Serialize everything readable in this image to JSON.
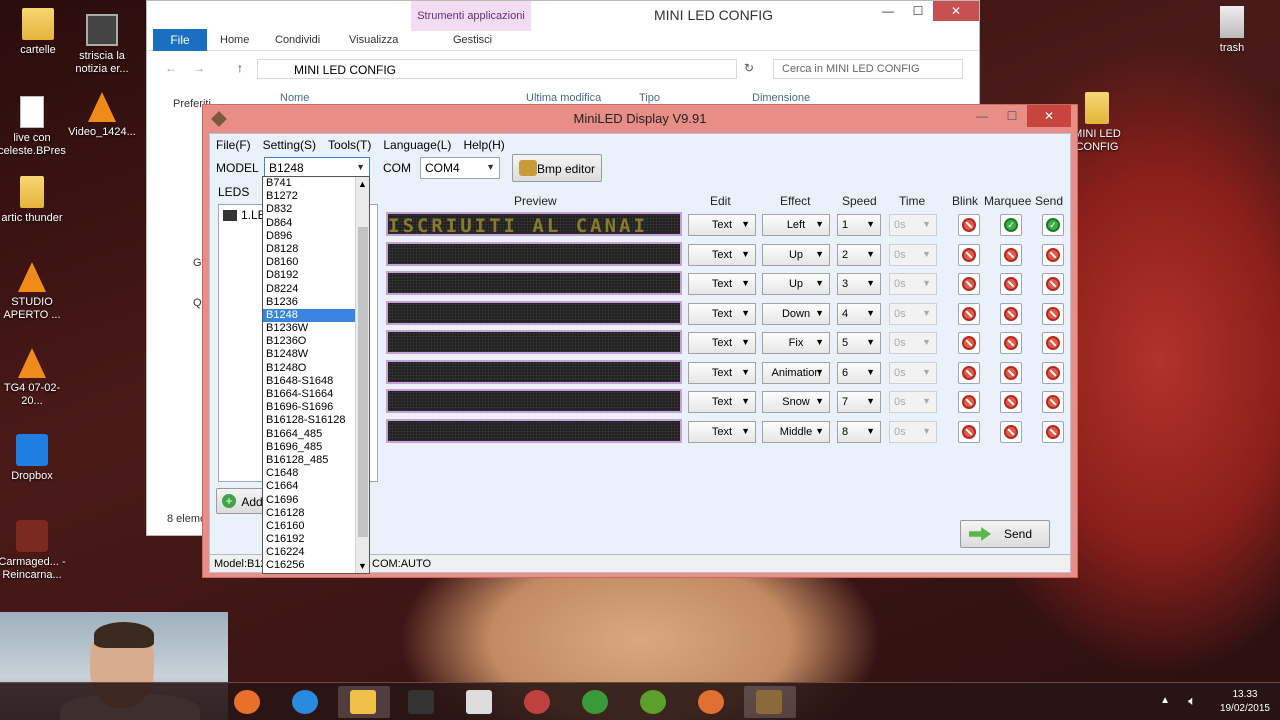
{
  "desktop": {
    "icons": [
      {
        "label": "cartelle",
        "icon": "folder"
      },
      {
        "label": "striscia la notizia er...",
        "icon": "video"
      },
      {
        "label": "trash",
        "icon": "recycle-bin"
      },
      {
        "label": "live con celeste.BPres",
        "icon": "file"
      },
      {
        "label": "Video_1424...",
        "icon": "vlc"
      },
      {
        "label": "artic thunder",
        "icon": "folder"
      },
      {
        "label": "STUDIO APERTO ...",
        "icon": "vlc"
      },
      {
        "label": "TG4 07-02-20...",
        "icon": "vlc"
      },
      {
        "label": "Dropbox",
        "icon": "dropbox"
      },
      {
        "label": "Carmaged... - Reincarna...",
        "icon": "game"
      },
      {
        "label": "MINI LED CONFIG",
        "icon": "folder"
      }
    ]
  },
  "explorer": {
    "title": "MINI LED CONFIG",
    "contextual_tab": "Strumenti applicazioni",
    "tabs": [
      "File",
      "Home",
      "Condividi",
      "Visualizza",
      "Gestisci"
    ],
    "address": "MINI LED CONFIG",
    "search_placeholder": "Cerca in MINI LED CONFIG",
    "columns": [
      "Nome",
      "Ultima modifica",
      "Tipo",
      "Dimensione"
    ],
    "sidebar": [
      "Preferiti",
      "Gr",
      "Q"
    ],
    "status": "8 eleme"
  },
  "app": {
    "title": "MiniLED Display V9.91",
    "menu": [
      "File(F)",
      "Setting(S)",
      "Tools(T)",
      "Language(L)",
      "Help(H)"
    ],
    "model_label": "MODEL",
    "model_value": "B1248",
    "com_label": "COM",
    "com_value": "COM4",
    "bmp_editor": "Bmp editor",
    "leds_label": "LEDS",
    "leds_item": "1.LE",
    "add_button": "Add",
    "headers": {
      "preview": "Preview",
      "edit": "Edit",
      "effect": "Effect",
      "speed": "Speed",
      "time": "Time",
      "blink": "Blink",
      "marquee": "Marquee",
      "send": "Send"
    },
    "preview_text": "ISCRIUITI AL CANAI",
    "rows": [
      {
        "edit": "Text",
        "effect": "Left",
        "speed": "1",
        "time": "0s",
        "marquee": "yes",
        "send": "yes"
      },
      {
        "edit": "Text",
        "effect": "Up",
        "speed": "2",
        "time": "0s",
        "marquee": "no",
        "send": "no"
      },
      {
        "edit": "Text",
        "effect": "Up",
        "speed": "3",
        "time": "0s",
        "marquee": "no",
        "send": "no"
      },
      {
        "edit": "Text",
        "effect": "Down",
        "speed": "4",
        "time": "0s",
        "marquee": "no",
        "send": "no"
      },
      {
        "edit": "Text",
        "effect": "Fix",
        "speed": "5",
        "time": "0s",
        "marquee": "no",
        "send": "no"
      },
      {
        "edit": "Text",
        "effect": "Animation",
        "speed": "6",
        "time": "0s",
        "marquee": "no",
        "send": "no"
      },
      {
        "edit": "Text",
        "effect": "Snow",
        "speed": "7",
        "time": "0s",
        "marquee": "no",
        "send": "no"
      },
      {
        "edit": "Text",
        "effect": "Middle",
        "speed": "8",
        "time": "0s",
        "marquee": "no",
        "send": "no"
      }
    ],
    "send_button": "Send",
    "status_model": "Model:B12",
    "status_com": "COM:AUTO",
    "model_options": [
      "B741",
      "B1272",
      "D832",
      "D864",
      "D896",
      "D8128",
      "D8160",
      "D8192",
      "D8224",
      "B1236",
      "B1248",
      "B1236W",
      "B1236O",
      "B1248W",
      "B1248O",
      "B1648-S1648",
      "B1664-S1664",
      "B1696-S1696",
      "B16128-S16128",
      "B1664_485",
      "B1696_485",
      "B16128_485",
      "C1648",
      "C1664",
      "C1696",
      "C16128",
      "C16160",
      "C16192",
      "C16224",
      "C16256"
    ],
    "model_selected": "B1248"
  },
  "taskbar": {
    "time": "13.33",
    "date": "19/02/2015",
    "apps": [
      "firefox",
      "internet-explorer",
      "file-explorer",
      "cmd",
      "archive",
      "paint",
      "chrome",
      "utorrent",
      "app-glove",
      "miniled"
    ]
  }
}
